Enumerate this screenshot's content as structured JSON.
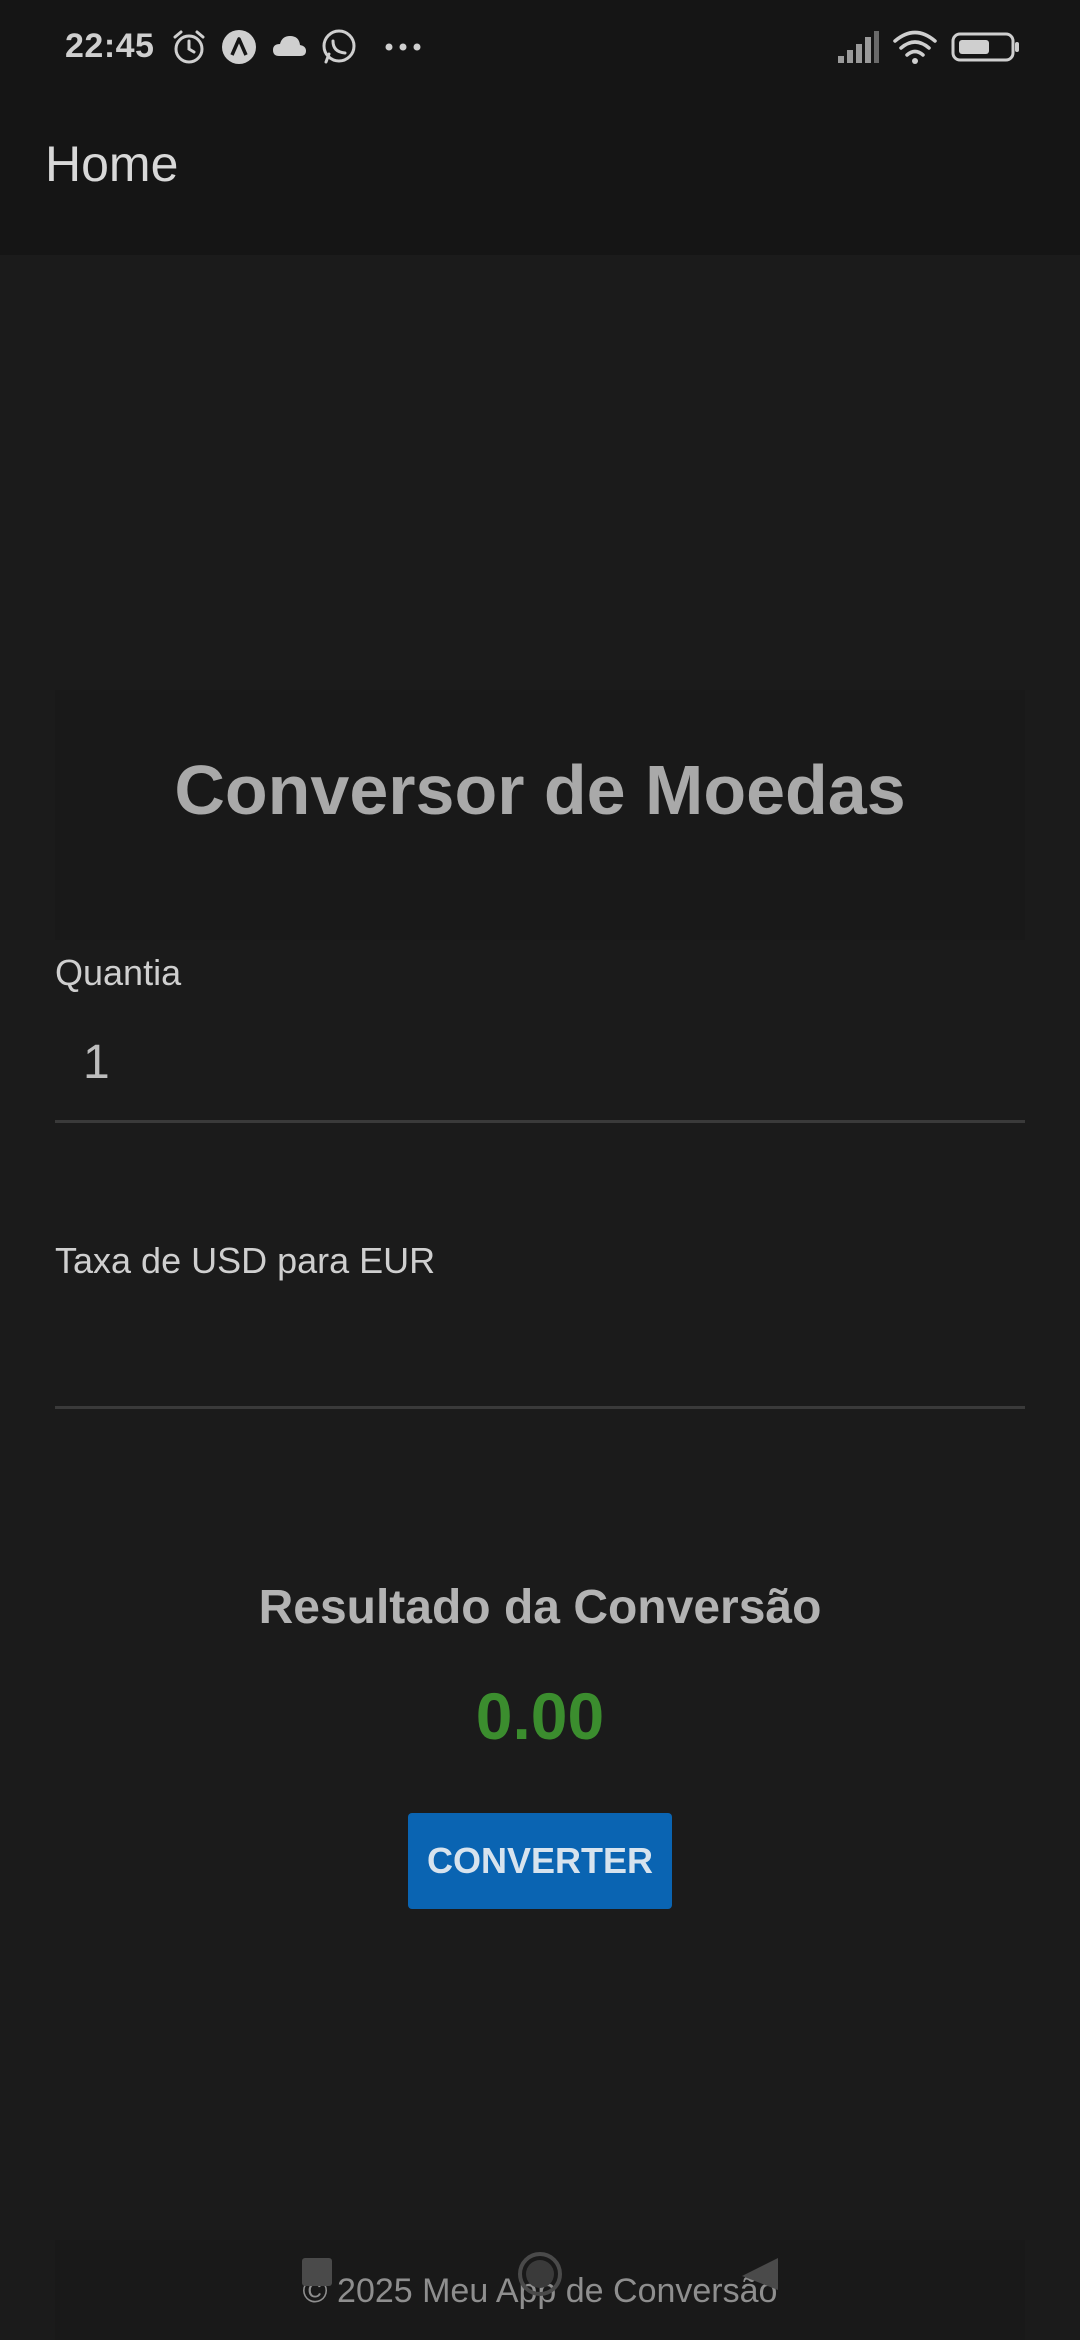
{
  "status_bar": {
    "time": "22:45",
    "left_icons": [
      "alarm-icon",
      "a-circle-icon",
      "cloud-icon",
      "whatsapp-icon",
      "more-icon"
    ],
    "right_icons": [
      "signal-icon",
      "wifi-icon",
      "battery-icon"
    ]
  },
  "app_bar": {
    "title": "Home"
  },
  "main": {
    "title": "Conversor de Moedas",
    "quantity": {
      "label": "Quantia",
      "value": "1"
    },
    "rate": {
      "label": "Taxa de USD para EUR",
      "value": ""
    },
    "result": {
      "title": "Resultado da Conversão",
      "value": "0.00"
    },
    "convert_label": "CONVERTER"
  },
  "footer": {
    "text": "© 2025 Meu App de Conversão"
  },
  "colors": {
    "background": "#1b1b1b",
    "bar": "#151515",
    "accent": "#0a64b2",
    "result": "#3b8d2e"
  },
  "system_nav": [
    "recents-icon",
    "home-icon",
    "back-icon"
  ]
}
